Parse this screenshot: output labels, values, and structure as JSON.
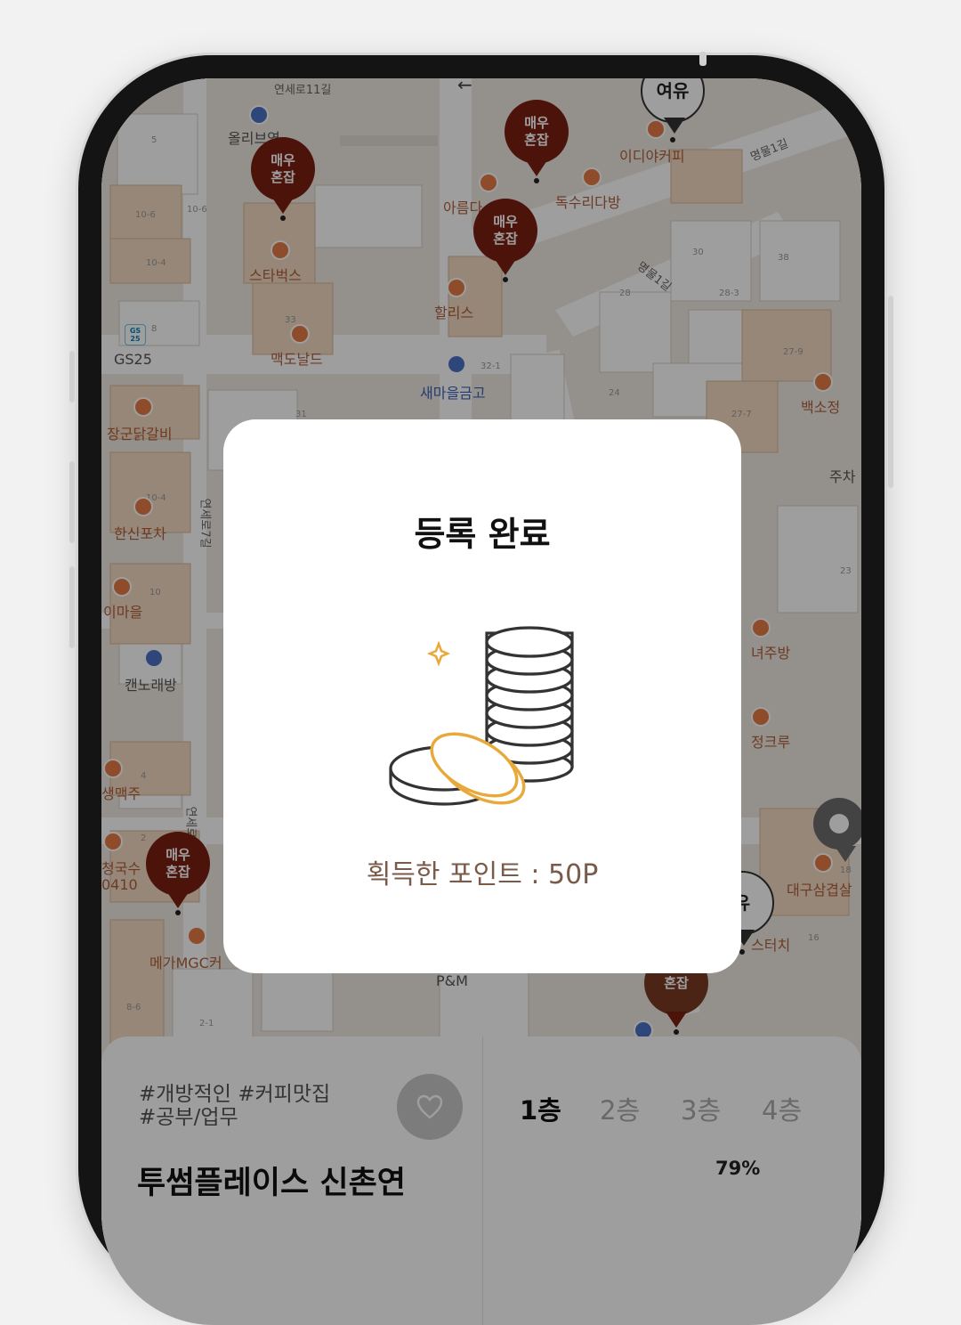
{
  "map": {
    "streets": [
      "연세로11길",
      "명물1길",
      "명물1길",
      "연세로7길",
      "연세로7길"
    ],
    "places": [
      {
        "name": "올리브영"
      },
      {
        "name": "스타벅스"
      },
      {
        "name": "GS25"
      },
      {
        "name": "맥도날드"
      },
      {
        "name": "이디야커피"
      },
      {
        "name": "독수리다방"
      },
      {
        "name": "아름다"
      },
      {
        "name": "할리스"
      },
      {
        "name": "새마을금고"
      },
      {
        "name": "장군닭갈비"
      },
      {
        "name": "한신포차"
      },
      {
        "name": "이마을"
      },
      {
        "name": "캔노래방"
      },
      {
        "name": "생맥주"
      },
      {
        "name": "청국수"
      },
      {
        "name": "0410"
      },
      {
        "name": "메가MGC커"
      },
      {
        "name": "백소정"
      },
      {
        "name": "주차"
      },
      {
        "name": "녀주방"
      },
      {
        "name": "정크루"
      },
      {
        "name": "대구삼겹살"
      },
      {
        "name": "스터치"
      },
      {
        "name": "P&M"
      }
    ],
    "parcels": [
      "5",
      "10-6",
      "10-6",
      "10-4",
      "8",
      "33",
      "32-1",
      "31",
      "30",
      "28",
      "28-3",
      "38",
      "27-9",
      "27-7",
      "24",
      "10-4",
      "10",
      "4",
      "2",
      "8-6",
      "2-1",
      "23",
      "16",
      "18"
    ],
    "pins": [
      {
        "label": "매우 혼잡",
        "style": "crowded"
      },
      {
        "label": "매우 혼잡",
        "style": "crowded"
      },
      {
        "label": "매우 혼잡",
        "style": "crowded"
      },
      {
        "label": "매우 혼잡",
        "style": "crowded"
      },
      {
        "label": "여유",
        "style": "free"
      },
      {
        "label": "유",
        "style": "free"
      },
      {
        "label": "혼잡",
        "style": "busy"
      }
    ],
    "gs25_logo": "GS 25"
  },
  "place_sheet": {
    "tags_line1": "#개방적인 #커피맛집",
    "tags_line2": "#공부/업무",
    "name": "투썸플레이스 신촌연",
    "favorite_icon": "heart-icon",
    "floors": [
      "1층",
      "2층",
      "3층",
      "4층"
    ],
    "active_floor": "1층",
    "occupancy": "79%"
  },
  "modal": {
    "title": "등록 완료",
    "icon": "coins-icon",
    "points_text": "획득한 포인트 : 50P"
  },
  "colors": {
    "pin_crowded": "#7a1f10",
    "poi": "#e57b46",
    "coin_gold": "#e8a93a",
    "points_text": "#7a5a48"
  }
}
